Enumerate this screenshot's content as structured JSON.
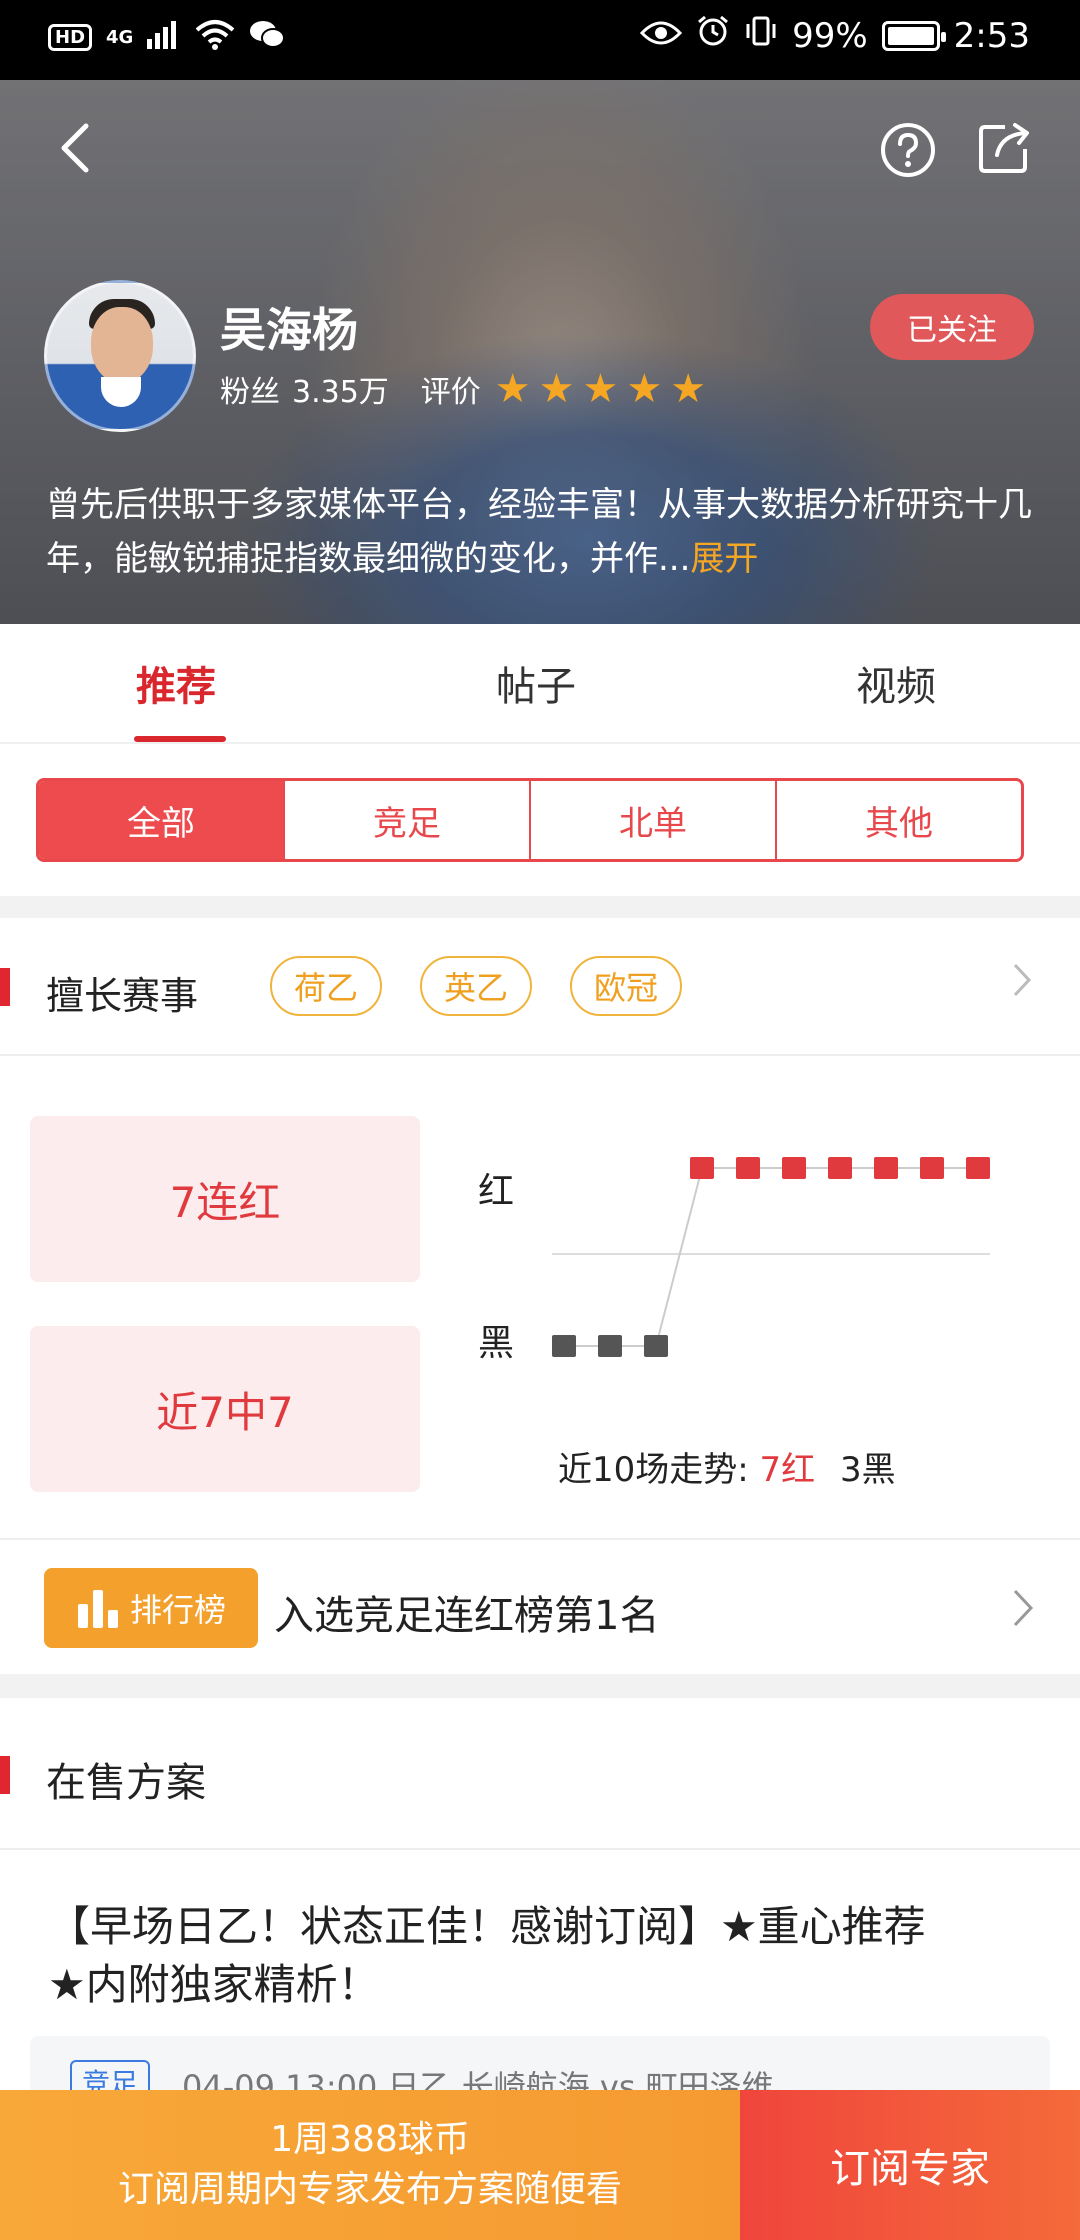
{
  "status_bar": {
    "network_badge": "HD",
    "network_type": "4G",
    "battery": "99%",
    "battery_level": 0.99,
    "time": "2:53"
  },
  "header": {
    "back_icon": "back-arrow-icon",
    "help_icon": "question-circle-icon",
    "share_icon": "share-icon"
  },
  "expert": {
    "name": "吴海杨",
    "fans_label": "粉丝",
    "fans_count": "3.35万",
    "rating_label": "评价",
    "rating_stars": 5,
    "follow_label": "已关注",
    "bio": "曾先后供职于多家媒体平台，经验丰富！从事大数据分析研究十几年，能敏锐捕捉指数最细微的变化，并作...",
    "bio_more": "展开"
  },
  "tabs": [
    {
      "label": "推荐",
      "active": true
    },
    {
      "label": "帖子",
      "active": false
    },
    {
      "label": "视频",
      "active": false
    }
  ],
  "filters": [
    {
      "label": "全部",
      "active": true
    },
    {
      "label": "竞足",
      "active": false
    },
    {
      "label": "北单",
      "active": false
    },
    {
      "label": "其他",
      "active": false
    }
  ],
  "specialty": {
    "title": "擅长赛事",
    "tags": [
      "荷乙",
      "英乙",
      "欧冠"
    ]
  },
  "stats": {
    "streak": "7连红",
    "recent": "近7中7",
    "red_label": "红",
    "black_label": "黑",
    "summary_prefix": "近10场走势:",
    "summary_red": "7红",
    "summary_black": "3黑"
  },
  "chart_data": {
    "type": "line",
    "x": [
      1,
      2,
      3,
      4,
      5,
      6,
      7,
      8,
      9,
      10
    ],
    "series": [
      {
        "values": [
          "黑",
          "黑",
          "黑",
          "红",
          "红",
          "红",
          "红",
          "红",
          "红",
          "红"
        ]
      }
    ],
    "categories_y": [
      "黑",
      "红"
    ],
    "colors": {
      "red": "#e03a3e",
      "black": "#555555"
    }
  },
  "ranking": {
    "badge": "排行榜",
    "text": "入选竞足连红榜第1名"
  },
  "on_sale": {
    "title": "在售方案",
    "plan_title": "【早场日乙！状态正佳！感谢订阅】★重心推荐★内附独家精析！",
    "plan_type": "竞足",
    "plan_match": "04-09 13:00 日乙 长崎航海 vs 町田泽维"
  },
  "subscribe": {
    "price": "1周388球币",
    "note": "订阅周期内专家发布方案随便看",
    "button": "订阅专家"
  },
  "colors": {
    "accent_red": "#e8484c",
    "orange": "#f5a623",
    "cta_orange": "#f8a838",
    "cta_red": "#f0453c"
  }
}
